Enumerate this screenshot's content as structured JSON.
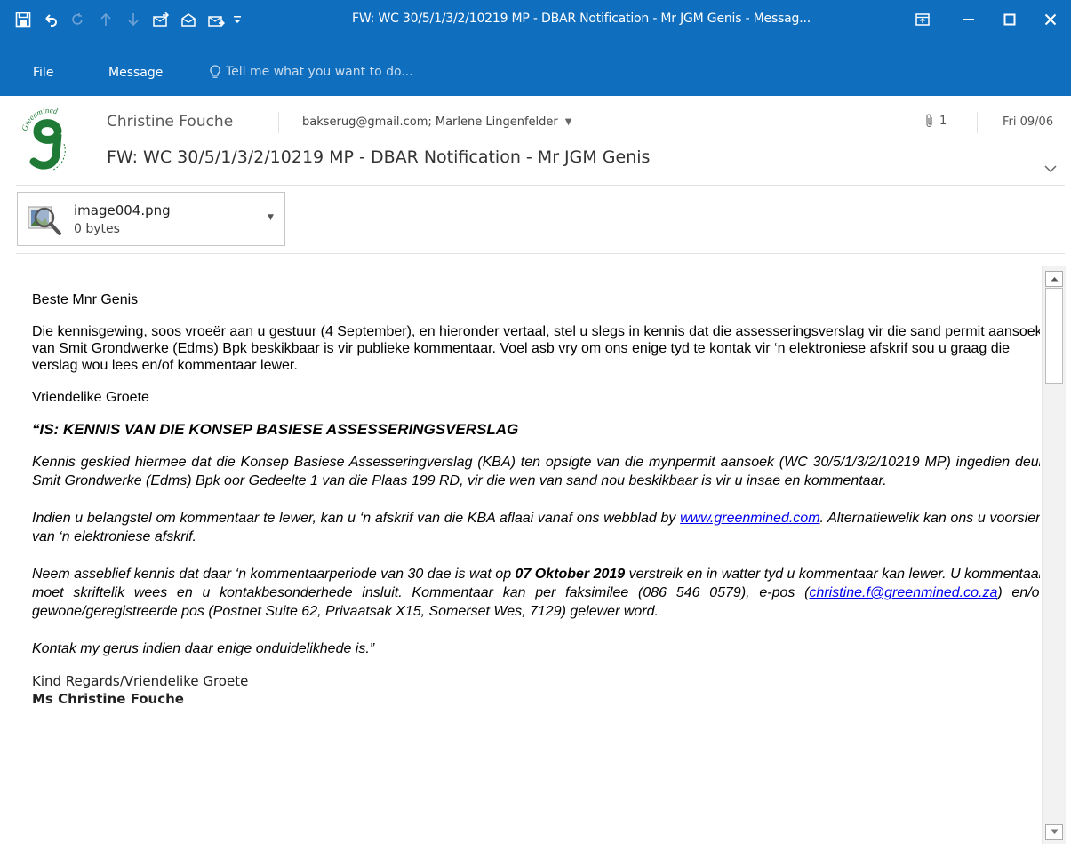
{
  "window": {
    "title": "FW: WC 30/5/1/3/2/10219 MP - DBAR Notification - Mr JGM Genis - Messag..."
  },
  "ribbon": {
    "tabs": [
      "File",
      "Message"
    ],
    "tell_me_placeholder": "Tell me what you want to do..."
  },
  "header": {
    "sender": "Christine Fouche",
    "recipients": "bakserug@gmail.com; Marlene Lingenfelder",
    "attachment_count": "1",
    "date": "Fri 09/06",
    "subject": "FW: WC 30/5/1/3/2/10219 MP - DBAR Notification - Mr JGM Genis",
    "logo_text": "Greenmined"
  },
  "attachment": {
    "name": "image004.png",
    "size": "0 bytes"
  },
  "body": {
    "greeting": "Beste Mnr Genis",
    "para1": "Die kennisgewing, soos vroeër aan u gestuur (4 September), en hieronder vertaal, stel u slegs in kennis dat die assesseringsverslag vir die sand permit aansoek van Smit Grondwerke (Edms) Bpk beskikbaar is vir publieke kommentaar.  Voel asb vry om ons enige tyd te kontak vir ‘n elektroniese afskrif sou u graag die verslag wou lees en/of kommentaar lewer.",
    "regards1": "Vriendelike Groete",
    "heading": "“IS: KENNIS VAN DIE KONSEP BASIESE ASSESSERINGSVERSLAG",
    "para2": "Kennis geskied hiermee dat die Konsep Basiese Assesseringverslag (KBA) ten opsigte van die mynpermit aansoek (WC 30/5/1/3/2/10219 MP) ingedien deur Smit Grondwerke (Edms) Bpk oor Gedeelte 1 van die Plaas 199 RD, vir die wen van sand nou beskikbaar is vir u insae en kommentaar.",
    "para3_a": "Indien u belangstel om kommentaar te lewer, kan u ‘n afskrif van die KBA aflaai vanaf ons webblad by ",
    "para3_link": "www.greenmined.com",
    "para3_b": ".  Alternatiewelik kan ons u voorsien van ‘n elektroniese afskrif.",
    "para4_a": "Neem asseblief kennis dat daar ‘n kommentaarperiode van 30 dae is wat op ",
    "para4_bold": "07 Oktober 2019",
    "para4_b": " verstreik en in watter tyd u kommentaar kan lewer. U kommentaar moet skriftelik wees en u kontakbesonderhede insluit. Kommentaar kan per faksimilee (086 546 0579), e-pos (",
    "para4_link": "christine.f@greenmined.co.za",
    "para4_c": ") en/of gewone/geregistreerde pos (Postnet Suite 62, Privaatsak X15, Somerset Wes, 7129) gelewer word.",
    "para5": "Kontak my gerus indien daar enige onduidelikhede is.”",
    "sig_regards": "Kind Regards/Vriendelike Groete",
    "sig_name": "Ms Christine Fouche"
  },
  "colors": {
    "titlebar": "#106ebe",
    "link": "#0000ee",
    "logo_green": "#1f7a36"
  }
}
